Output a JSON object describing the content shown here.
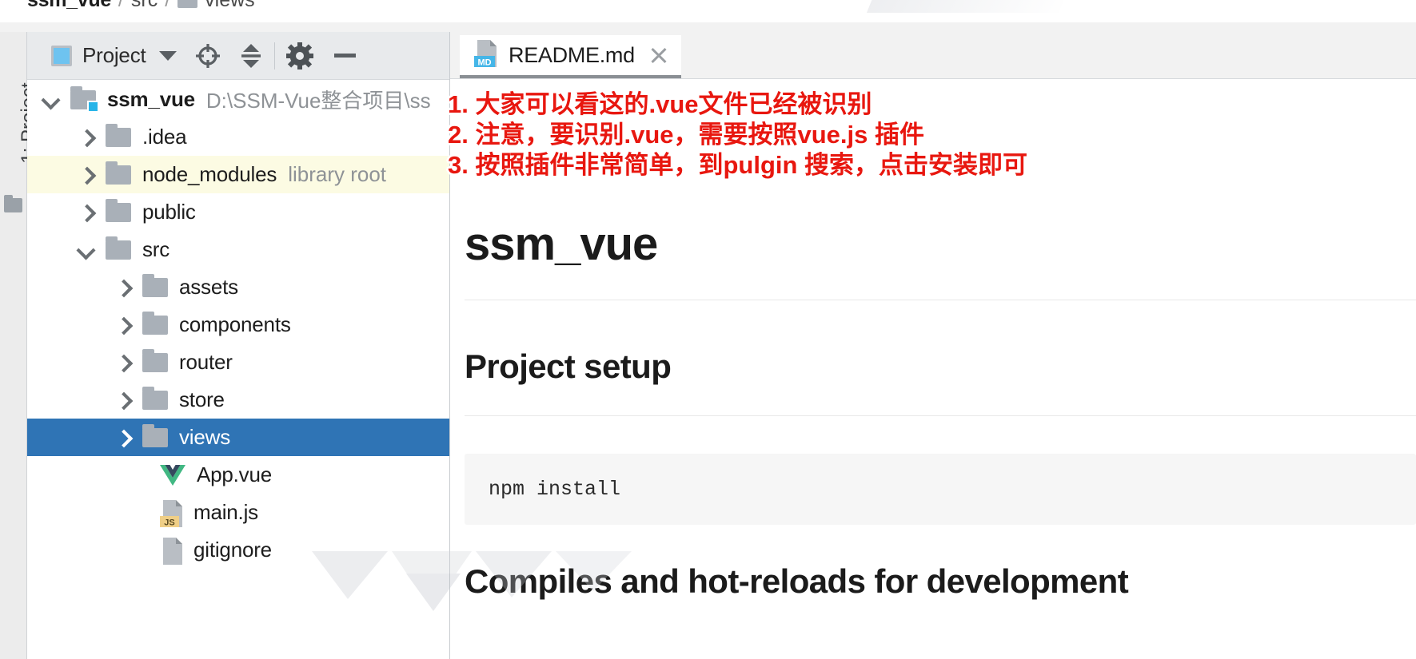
{
  "breadcrumb": {
    "items": [
      {
        "label": "ssm_vue",
        "style": "bold",
        "icon": "none"
      },
      {
        "label": "src",
        "style": "plain",
        "icon": "none"
      },
      {
        "label": "views",
        "style": "plain",
        "icon": "folder-icon"
      }
    ],
    "separator": "/"
  },
  "left_strip": {
    "label_number": "1:",
    "label_text": "Project",
    "folder_icon": "folder-icon"
  },
  "project_panel": {
    "toolbar": {
      "icon": "project-view-icon",
      "title": "Project",
      "dropdown_icon": "chevron-down-icon",
      "locate_icon": "crosshair-target-icon",
      "collapse_icon": "collapse-all-icon",
      "settings_icon": "gear-icon",
      "hide_icon": "minimize-icon"
    },
    "tree": [
      {
        "label": "ssm_vue",
        "hint": "D:\\SSM-Vue整合项目\\ss",
        "arrow": "down",
        "icon": "folder-module-icon",
        "indent": "ind0",
        "bold": true,
        "state": "normal"
      },
      {
        "label": ".idea",
        "hint": "",
        "arrow": "right",
        "icon": "folder-icon",
        "indent": "ind1",
        "bold": false,
        "state": "normal"
      },
      {
        "label": "node_modules",
        "hint": "library root",
        "arrow": "right",
        "icon": "folder-icon",
        "indent": "ind1",
        "bold": false,
        "state": "yellow"
      },
      {
        "label": "public",
        "hint": "",
        "arrow": "right",
        "icon": "folder-icon",
        "indent": "ind1",
        "bold": false,
        "state": "normal"
      },
      {
        "label": "src",
        "hint": "",
        "arrow": "down",
        "icon": "folder-icon",
        "indent": "ind1",
        "bold": false,
        "state": "normal"
      },
      {
        "label": "assets",
        "hint": "",
        "arrow": "right",
        "icon": "folder-icon",
        "indent": "ind2",
        "bold": false,
        "state": "normal"
      },
      {
        "label": "components",
        "hint": "",
        "arrow": "right",
        "icon": "folder-icon",
        "indent": "ind2",
        "bold": false,
        "state": "normal"
      },
      {
        "label": "router",
        "hint": "",
        "arrow": "right",
        "icon": "folder-icon",
        "indent": "ind2",
        "bold": false,
        "state": "normal"
      },
      {
        "label": "store",
        "hint": "",
        "arrow": "right",
        "icon": "folder-icon",
        "indent": "ind2",
        "bold": false,
        "state": "normal"
      },
      {
        "label": "views",
        "hint": "",
        "arrow": "right",
        "icon": "folder-icon",
        "indent": "ind2",
        "bold": false,
        "state": "selected"
      },
      {
        "label": "App.vue",
        "hint": "",
        "arrow": "none",
        "icon": "vue-file-icon",
        "indent": "ind2b",
        "bold": false,
        "state": "normal"
      },
      {
        "label": "main.js",
        "hint": "",
        "arrow": "none",
        "icon": "js-file-icon",
        "indent": "ind2b",
        "bold": false,
        "state": "normal"
      },
      {
        "label": "gitignore",
        "hint": "",
        "arrow": "none",
        "icon": "file-icon",
        "indent": "ind2b",
        "bold": false,
        "state": "normal"
      }
    ]
  },
  "editor": {
    "tab": {
      "label": "README.md",
      "icon": "markdown-file-icon",
      "badge": "MD",
      "close_icon": "close-icon"
    },
    "preview": {
      "h1": "ssm_vue",
      "h2_project_setup": "Project setup",
      "code_npm_install": "npm install",
      "h2_compiles": "Compiles and hot-reloads for development"
    }
  },
  "annotations": {
    "color": "#e8170f",
    "lines": [
      "1. 大家可以看这的.vue文件已经被识别",
      "2. 注意，要识别.vue，需要按照vue.js 插件",
      "3. 按照插件非常简单，到pulgin 搜索，点击安装即可"
    ]
  },
  "colors": {
    "selection_blue": "#2f74b5",
    "library_yellow": "#fcfbe3",
    "toolbar_gray": "#e8eaec",
    "vue_green": "#41b883",
    "vue_dark": "#35495e",
    "js_yellow": "#f0d090",
    "md_blue": "#45b6e8",
    "annotation_red": "#e8170f"
  }
}
